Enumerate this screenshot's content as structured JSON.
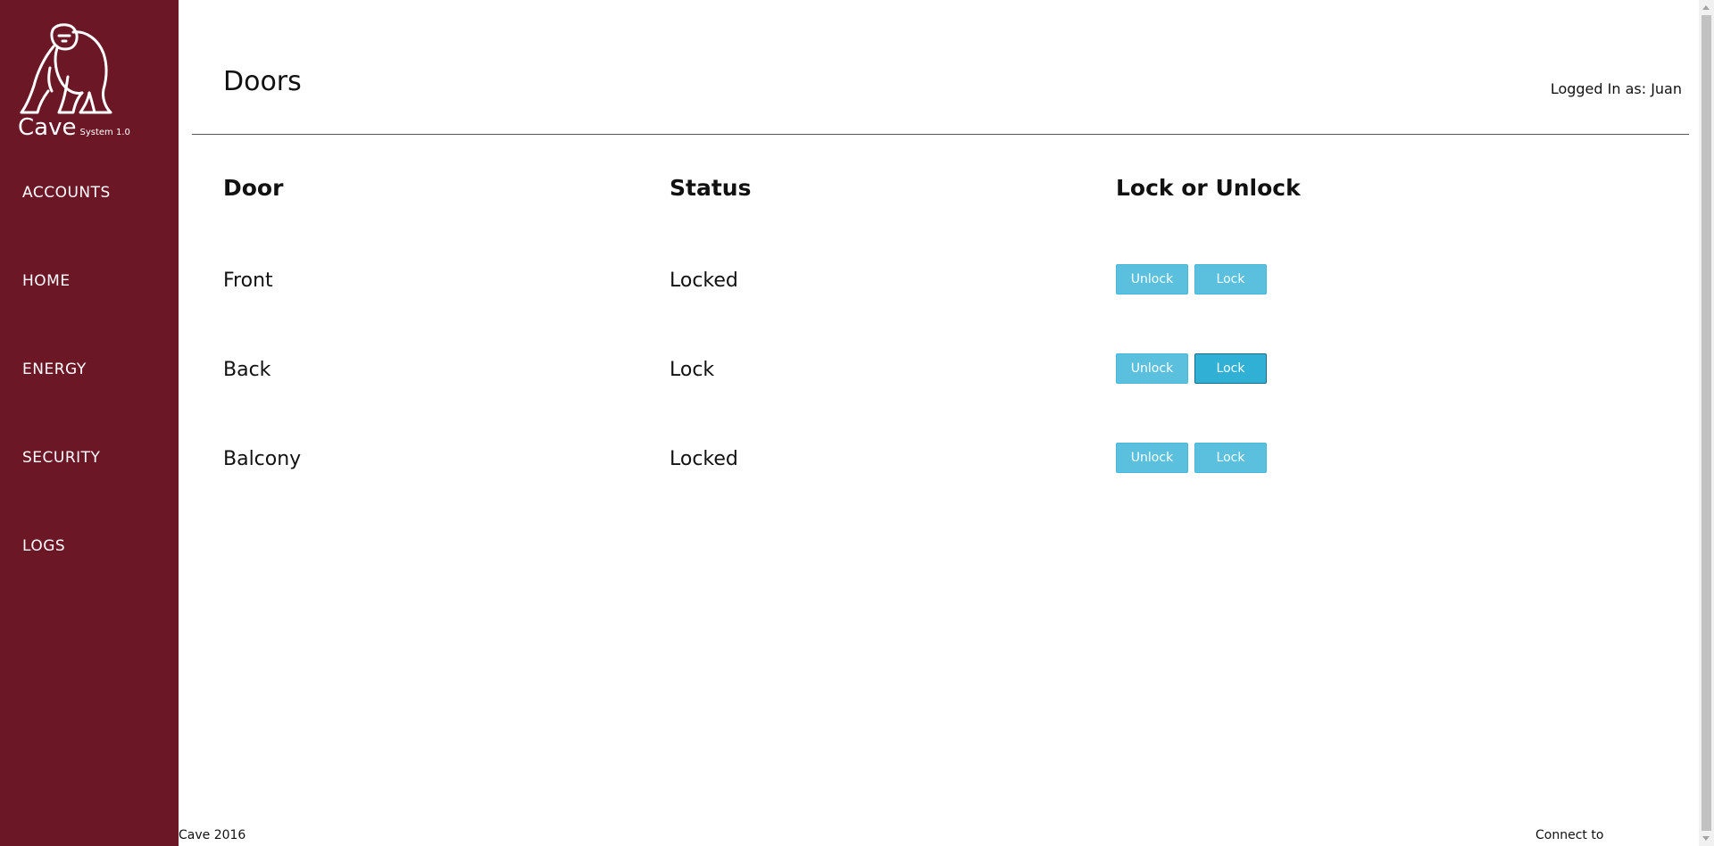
{
  "app": {
    "name": "Cave",
    "version": "System 1.0",
    "logo_icon": "gorilla-icon",
    "brand_color": "#6b1726",
    "button_color": "#5bc0de"
  },
  "sidebar": {
    "items": [
      {
        "label": "ACCOUNTS"
      },
      {
        "label": "HOME"
      },
      {
        "label": "ENERGY"
      },
      {
        "label": "SECURITY"
      },
      {
        "label": "LOGS"
      }
    ]
  },
  "header": {
    "title": "Doors",
    "user_text": "Logged In as: Juan"
  },
  "table": {
    "headers": [
      "Door",
      "Status",
      "Lock or Unlock"
    ],
    "rows": [
      {
        "door": "Front",
        "status": "Locked",
        "unlock_label": "Unlock",
        "lock_label": "Lock"
      },
      {
        "door": "Back",
        "status": "Lock",
        "unlock_label": "Unlock",
        "lock_label": "Lock"
      },
      {
        "door": "Balcony",
        "status": "Locked",
        "unlock_label": "Unlock",
        "lock_label": "Lock"
      }
    ]
  },
  "footer": {
    "left": "Cave 2016",
    "right": "Connect to"
  }
}
